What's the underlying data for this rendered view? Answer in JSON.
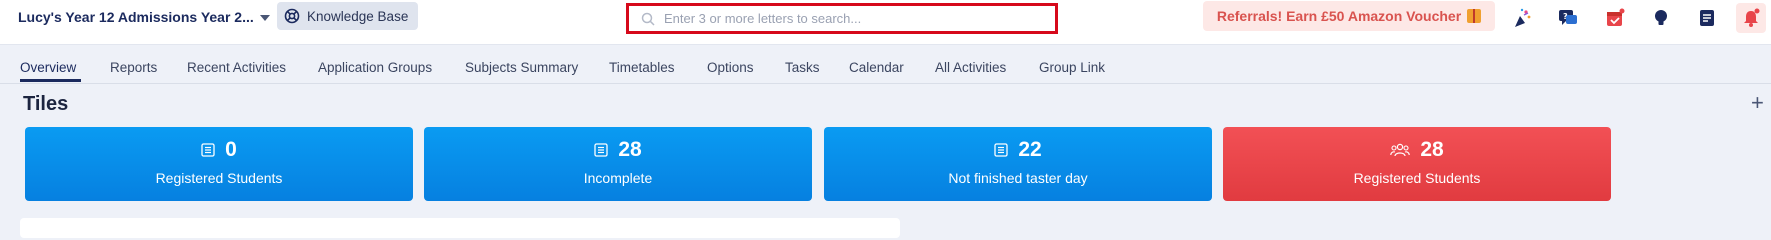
{
  "header": {
    "title": "Lucy's Year 12 Admissions Year 2...",
    "knowledge_base": "Knowledge Base",
    "search": {
      "placeholder": "Enter 3 or more letters to search..."
    },
    "referral": "Referrals! Earn £50 Amazon Voucher",
    "icons": [
      "celebration-icon",
      "help-chat-icon",
      "calendar-icon",
      "idea-bulb-icon",
      "notes-icon",
      "notification-bell-icon"
    ]
  },
  "tabs": [
    "Overview",
    "Reports",
    "Recent Activities",
    "Application Groups",
    "Subjects Summary",
    "Timetables",
    "Options",
    "Tasks",
    "Calendar",
    "All Activities",
    "Group Link"
  ],
  "active_tab": "Overview",
  "tiles_section": {
    "title": "Tiles",
    "tiles": [
      {
        "value": "0",
        "label": "Registered Students",
        "icon": "list-icon",
        "color": "#0a8ff0"
      },
      {
        "value": "28",
        "label": "Incomplete",
        "icon": "list-icon",
        "color": "#0a8ff0"
      },
      {
        "value": "22",
        "label": "Not finished taster day",
        "icon": "list-icon",
        "color": "#0a8ff0"
      },
      {
        "value": "28",
        "label": "Registered Students",
        "icon": "users-icon",
        "color": "#e8454a"
      }
    ]
  },
  "colors": {
    "nav_text": "#1b2a5e",
    "search_highlight": "#d6091b",
    "referral_text": "#d9534f"
  }
}
